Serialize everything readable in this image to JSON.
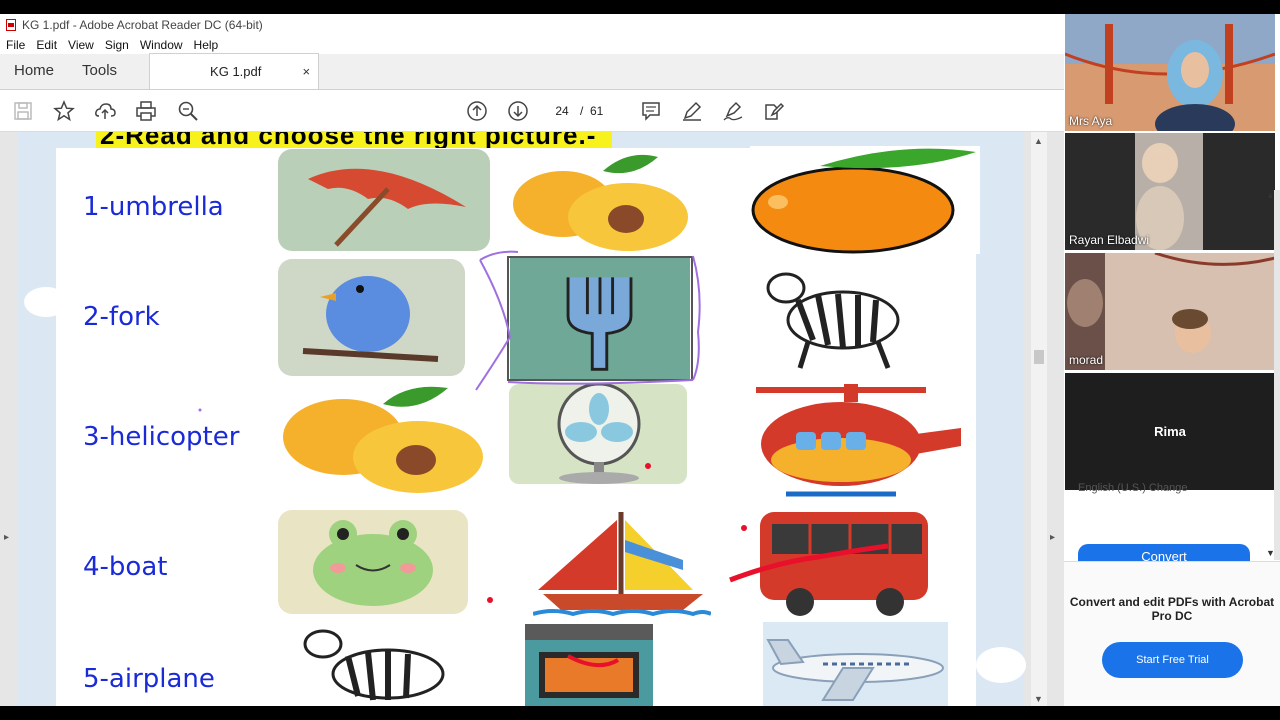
{
  "window": {
    "title": "KG 1.pdf - Adobe Acrobat Reader DC (64-bit)"
  },
  "menu": [
    "File",
    "Edit",
    "View",
    "Sign",
    "Window",
    "Help"
  ],
  "tabs": {
    "home": "Home",
    "tools": "Tools",
    "document": "KG 1.pdf",
    "close": "×"
  },
  "toolbar": {
    "current_page": "24",
    "separator": "/",
    "total_pages": "61"
  },
  "worksheet": {
    "heading": "2-Read and choose the right picture.-",
    "words": [
      "1-umbrella",
      "2-fork",
      "3-helicopter",
      "4-boat",
      "5-airplane"
    ]
  },
  "participants": [
    {
      "name": "Mrs Aya"
    },
    {
      "name": "Rayan Elbadwi"
    },
    {
      "name": "morad"
    },
    {
      "name": "Rima"
    }
  ],
  "right_panel": {
    "behind_text": "English (U.S.) Change",
    "convert_label": "Convert",
    "promo_text": "Convert and edit PDFs with Acrobat Pro DC",
    "trial_label": "Start Free Trial"
  },
  "colors": {
    "word_blue": "#1a2ad6",
    "heading_yellow": "#f7f21c",
    "accent_blue": "#1a73e8",
    "annotation_purple": "#a070e0",
    "annotation_red": "#e8102a"
  }
}
